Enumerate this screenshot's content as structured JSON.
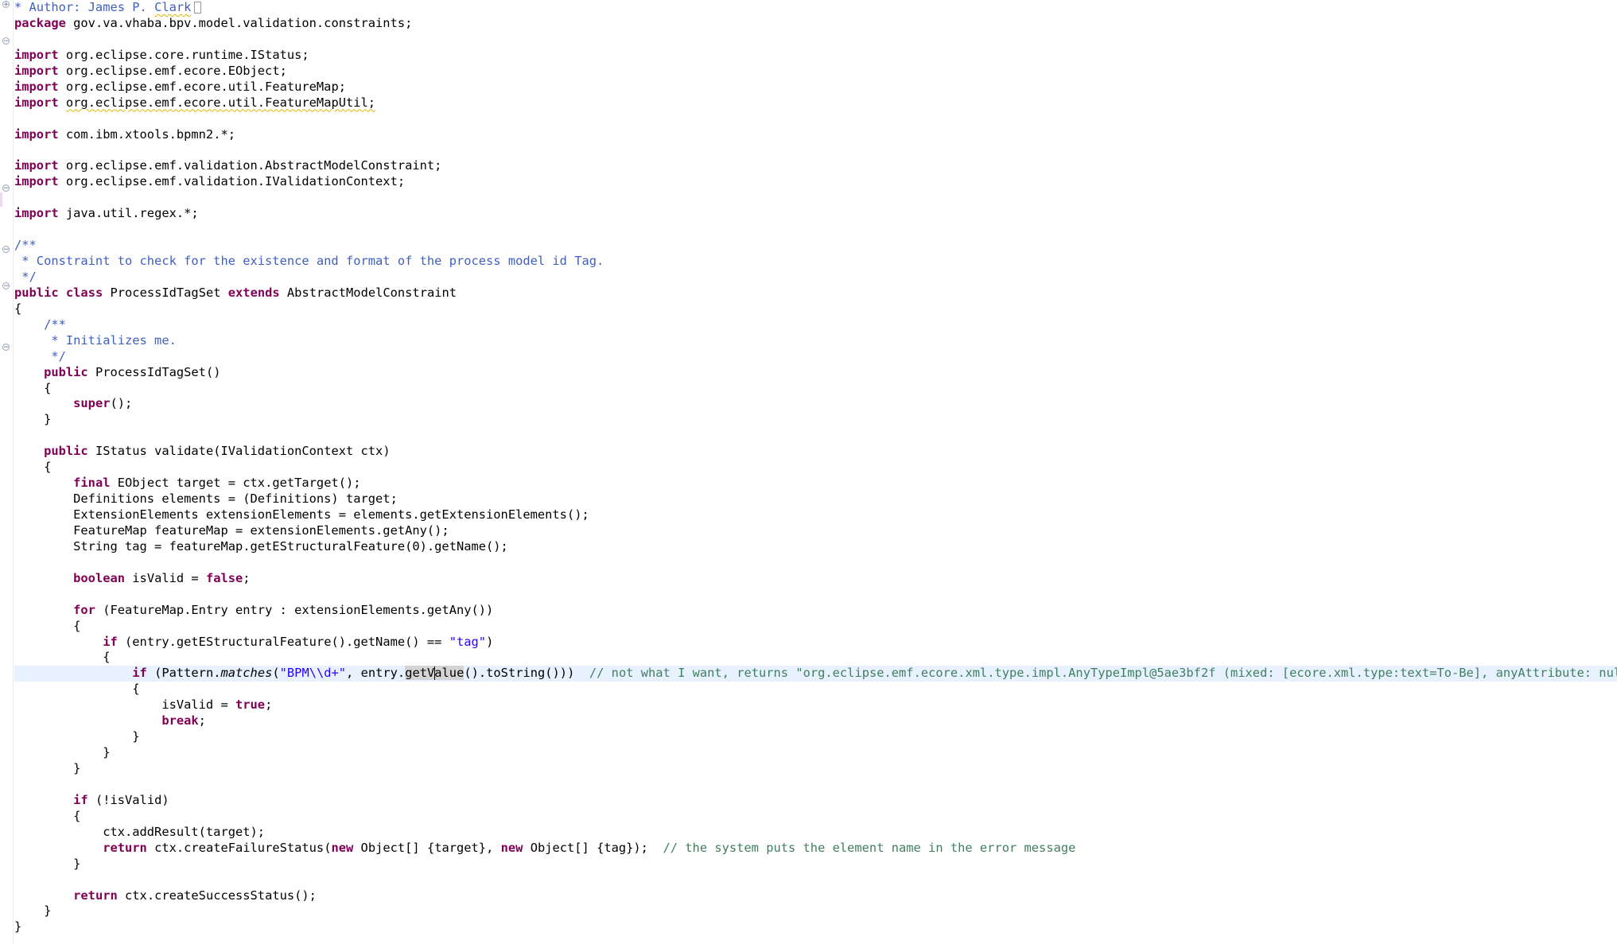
{
  "editor": {
    "colors": {
      "keyword": "#7f0055",
      "string": "#2a00ff",
      "javadoc": "#3f5fbf",
      "comment": "#3f7f5f",
      "current_line": "#e8f2fe"
    },
    "header": {
      "author_prefix": "* Author: James P. ",
      "author_last": "Clark"
    },
    "package": {
      "keyword": "package",
      "name": " gov.va.vhaba.bpv.model.validation.constraints;"
    },
    "imports": [
      {
        "keyword": "import",
        "path": " org.eclipse.core.runtime.IStatus;"
      },
      {
        "keyword": "import",
        "path": " org.eclipse.emf.ecore.EObject;"
      },
      {
        "keyword": "import",
        "path": " org.eclipse.emf.ecore.util.FeatureMap;"
      },
      {
        "keyword": "import",
        "path": "org.eclipse.emf.ecore.util.FeatureMapUtil;"
      },
      {
        "keyword": "import",
        "path": " com.ibm.xtools.bpmn2.*;"
      },
      {
        "keyword": "import",
        "path": " org.eclipse.emf.validation.AbstractModelConstraint;"
      },
      {
        "keyword": "import",
        "path": " org.eclipse.emf.validation.IValidationContext;"
      },
      {
        "keyword": "import",
        "path": " java.util.regex.*;"
      }
    ],
    "class_doc": {
      "open": "/**",
      "body": " * Constraint to check for the existence and format of the process model id Tag.",
      "close": " */"
    },
    "class_decl": {
      "kw_public": "public",
      "kw_class": "class",
      "name": " ProcessIdTagSet ",
      "kw_extends": "extends",
      "parent": " AbstractModelConstraint"
    },
    "ctor_doc": {
      "open": "    /**",
      "body": "     * Initializes me.",
      "close": "     */"
    },
    "ctor": {
      "indent": "    ",
      "kw_public": "public",
      "name": " ProcessIdTagSet()",
      "super_indent": "        ",
      "kw_super": "super",
      "super_rest": "();"
    },
    "validate": {
      "indent": "    ",
      "kw_public": "public",
      "signature": " IStatus validate(IValidationContext ctx)"
    },
    "body": {
      "l_final_kw": "final",
      "l_final_rest": " EObject target = ctx.getTarget();",
      "l_defs": "        Definitions elements = (Definitions) target;",
      "l_ext": "        ExtensionElements extensionElements = elements.getExtensionElements();",
      "l_fmap": "        FeatureMap featureMap = extensionElements.getAny();",
      "l_tag": "        String tag = featureMap.getEStructuralFeature(0).getName();",
      "l_bool_kw": "boolean",
      "l_bool_mid": " isValid = ",
      "l_bool_false": "false",
      "l_bool_end": ";",
      "l_for_kw": "for",
      "l_for_rest": " (FeatureMap.Entry entry : extensionElements.getAny())",
      "l_if1_kw": "if",
      "l_if1_rest": " (entry.getEStructuralFeature().getName() == ",
      "l_if1_str": "\"tag\"",
      "l_if1_end": ")",
      "l_if2_kw": "if",
      "l_if2_a": " (Pattern.",
      "l_if2_matches": "matches",
      "l_if2_b": "(",
      "l_if2_str": "\"BPM\\\\d+\"",
      "l_if2_c": ", entry.",
      "l_if2_occ1": "getV",
      "l_if2_occ2": "alue",
      "l_if2_d": "().toString()))  ",
      "l_if2_comment": "// not what I want, returns \"org.eclipse.emf.ecore.xml.type.impl.AnyTypeImpl@5ae3bf2f (mixed: [ecore.xml.type:text=To-Be], anyAttribute: null)\"",
      "l_true_mid": "isValid = ",
      "l_true_kw": "true",
      "l_true_end": ";",
      "l_break_kw": "break",
      "l_break_end": ";",
      "l_if3_kw": "if",
      "l_if3_rest": " (!isValid)",
      "l_add": "            ctx.addResult(target);",
      "l_ret1_kw": "return",
      "l_ret1_a": " ctx.createFailureStatus(",
      "l_ret1_new1": "new",
      "l_ret1_b": " Object[] {target}, ",
      "l_ret1_new2": "new",
      "l_ret1_c": " Object[] {tag});  ",
      "l_ret1_comment": "// the system puts the element name in the error message",
      "l_ret2_kw": "return",
      "l_ret2_rest": " ctx.createSuccessStatus();"
    },
    "braces": {
      "open": "{",
      "close": "}"
    }
  }
}
